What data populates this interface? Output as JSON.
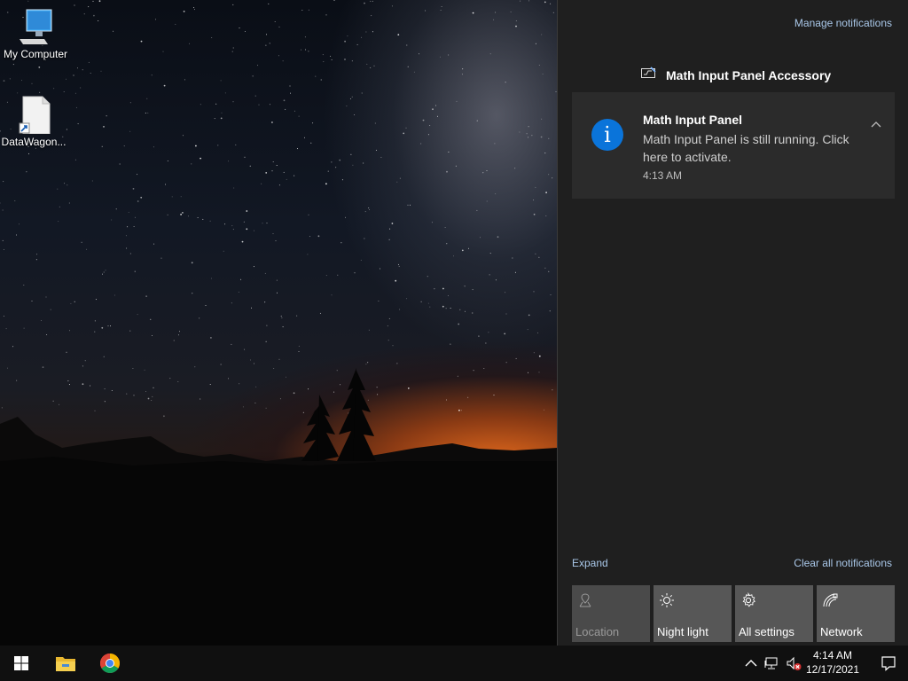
{
  "desktop": {
    "icons": [
      {
        "label": "My Computer",
        "icon": "computer-icon"
      },
      {
        "label": "DataWagon...",
        "icon": "shortcut-file-icon"
      }
    ]
  },
  "action_center": {
    "manage_label": "Manage notifications",
    "group_title": "Math Input Panel Accessory",
    "notification": {
      "title": "Math Input Panel",
      "body": "Math Input Panel is still running. Click here to activate.",
      "time": "4:13 AM",
      "icon_glyph": "i"
    },
    "expand_label": "Expand",
    "clear_label": "Clear all notifications",
    "quick_actions": [
      {
        "label": "Location",
        "icon": "location-icon",
        "enabled": false
      },
      {
        "label": "Night light",
        "icon": "night-light-icon",
        "enabled": true
      },
      {
        "label": "All settings",
        "icon": "gear-icon",
        "enabled": true
      },
      {
        "label": "Network",
        "icon": "network-icon",
        "enabled": true
      }
    ]
  },
  "taskbar": {
    "time": "4:14 AM",
    "date": "12/17/2021",
    "pinned": [
      "windows-start-icon",
      "file-explorer-icon",
      "chrome-icon"
    ],
    "tray": [
      "chevron-up-icon",
      "network-wired-icon",
      "volume-muted-icon"
    ]
  },
  "colors": {
    "accent": "#0a74da",
    "panel_bg": "#1f1f1f",
    "toast_bg": "#2b2b2b",
    "link": "#a9c7e8"
  }
}
